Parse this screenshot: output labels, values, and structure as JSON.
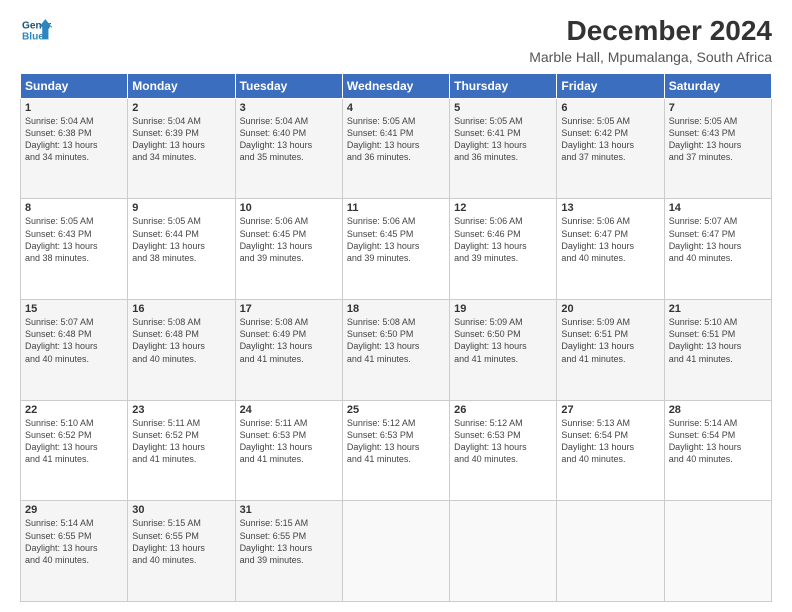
{
  "header": {
    "logo_line1": "General",
    "logo_line2": "Blue",
    "title": "December 2024",
    "subtitle": "Marble Hall, Mpumalanga, South Africa"
  },
  "calendar": {
    "days_of_week": [
      "Sunday",
      "Monday",
      "Tuesday",
      "Wednesday",
      "Thursday",
      "Friday",
      "Saturday"
    ],
    "weeks": [
      [
        {
          "day": "",
          "content": ""
        },
        {
          "day": "2",
          "content": "Sunrise: 5:04 AM\nSunset: 6:39 PM\nDaylight: 13 hours\nand 34 minutes."
        },
        {
          "day": "3",
          "content": "Sunrise: 5:04 AM\nSunset: 6:40 PM\nDaylight: 13 hours\nand 35 minutes."
        },
        {
          "day": "4",
          "content": "Sunrise: 5:05 AM\nSunset: 6:41 PM\nDaylight: 13 hours\nand 36 minutes."
        },
        {
          "day": "5",
          "content": "Sunrise: 5:05 AM\nSunset: 6:41 PM\nDaylight: 13 hours\nand 36 minutes."
        },
        {
          "day": "6",
          "content": "Sunrise: 5:05 AM\nSunset: 6:42 PM\nDaylight: 13 hours\nand 37 minutes."
        },
        {
          "day": "7",
          "content": "Sunrise: 5:05 AM\nSunset: 6:43 PM\nDaylight: 13 hours\nand 37 minutes."
        }
      ],
      [
        {
          "day": "8",
          "content": "Sunrise: 5:05 AM\nSunset: 6:43 PM\nDaylight: 13 hours\nand 38 minutes."
        },
        {
          "day": "9",
          "content": "Sunrise: 5:05 AM\nSunset: 6:44 PM\nDaylight: 13 hours\nand 38 minutes."
        },
        {
          "day": "10",
          "content": "Sunrise: 5:06 AM\nSunset: 6:45 PM\nDaylight: 13 hours\nand 39 minutes."
        },
        {
          "day": "11",
          "content": "Sunrise: 5:06 AM\nSunset: 6:45 PM\nDaylight: 13 hours\nand 39 minutes."
        },
        {
          "day": "12",
          "content": "Sunrise: 5:06 AM\nSunset: 6:46 PM\nDaylight: 13 hours\nand 39 minutes."
        },
        {
          "day": "13",
          "content": "Sunrise: 5:06 AM\nSunset: 6:47 PM\nDaylight: 13 hours\nand 40 minutes."
        },
        {
          "day": "14",
          "content": "Sunrise: 5:07 AM\nSunset: 6:47 PM\nDaylight: 13 hours\nand 40 minutes."
        }
      ],
      [
        {
          "day": "15",
          "content": "Sunrise: 5:07 AM\nSunset: 6:48 PM\nDaylight: 13 hours\nand 40 minutes."
        },
        {
          "day": "16",
          "content": "Sunrise: 5:08 AM\nSunset: 6:48 PM\nDaylight: 13 hours\nand 40 minutes."
        },
        {
          "day": "17",
          "content": "Sunrise: 5:08 AM\nSunset: 6:49 PM\nDaylight: 13 hours\nand 41 minutes."
        },
        {
          "day": "18",
          "content": "Sunrise: 5:08 AM\nSunset: 6:50 PM\nDaylight: 13 hours\nand 41 minutes."
        },
        {
          "day": "19",
          "content": "Sunrise: 5:09 AM\nSunset: 6:50 PM\nDaylight: 13 hours\nand 41 minutes."
        },
        {
          "day": "20",
          "content": "Sunrise: 5:09 AM\nSunset: 6:51 PM\nDaylight: 13 hours\nand 41 minutes."
        },
        {
          "day": "21",
          "content": "Sunrise: 5:10 AM\nSunset: 6:51 PM\nDaylight: 13 hours\nand 41 minutes."
        }
      ],
      [
        {
          "day": "22",
          "content": "Sunrise: 5:10 AM\nSunset: 6:52 PM\nDaylight: 13 hours\nand 41 minutes."
        },
        {
          "day": "23",
          "content": "Sunrise: 5:11 AM\nSunset: 6:52 PM\nDaylight: 13 hours\nand 41 minutes."
        },
        {
          "day": "24",
          "content": "Sunrise: 5:11 AM\nSunset: 6:53 PM\nDaylight: 13 hours\nand 41 minutes."
        },
        {
          "day": "25",
          "content": "Sunrise: 5:12 AM\nSunset: 6:53 PM\nDaylight: 13 hours\nand 41 minutes."
        },
        {
          "day": "26",
          "content": "Sunrise: 5:12 AM\nSunset: 6:53 PM\nDaylight: 13 hours\nand 40 minutes."
        },
        {
          "day": "27",
          "content": "Sunrise: 5:13 AM\nSunset: 6:54 PM\nDaylight: 13 hours\nand 40 minutes."
        },
        {
          "day": "28",
          "content": "Sunrise: 5:14 AM\nSunset: 6:54 PM\nDaylight: 13 hours\nand 40 minutes."
        }
      ],
      [
        {
          "day": "29",
          "content": "Sunrise: 5:14 AM\nSunset: 6:55 PM\nDaylight: 13 hours\nand 40 minutes."
        },
        {
          "day": "30",
          "content": "Sunrise: 5:15 AM\nSunset: 6:55 PM\nDaylight: 13 hours\nand 40 minutes."
        },
        {
          "day": "31",
          "content": "Sunrise: 5:15 AM\nSunset: 6:55 PM\nDaylight: 13 hours\nand 39 minutes."
        },
        {
          "day": "",
          "content": ""
        },
        {
          "day": "",
          "content": ""
        },
        {
          "day": "",
          "content": ""
        },
        {
          "day": "",
          "content": ""
        }
      ]
    ],
    "week1_day1": {
      "day": "1",
      "content": "Sunrise: 5:04 AM\nSunset: 6:38 PM\nDaylight: 13 hours\nand 34 minutes."
    }
  }
}
